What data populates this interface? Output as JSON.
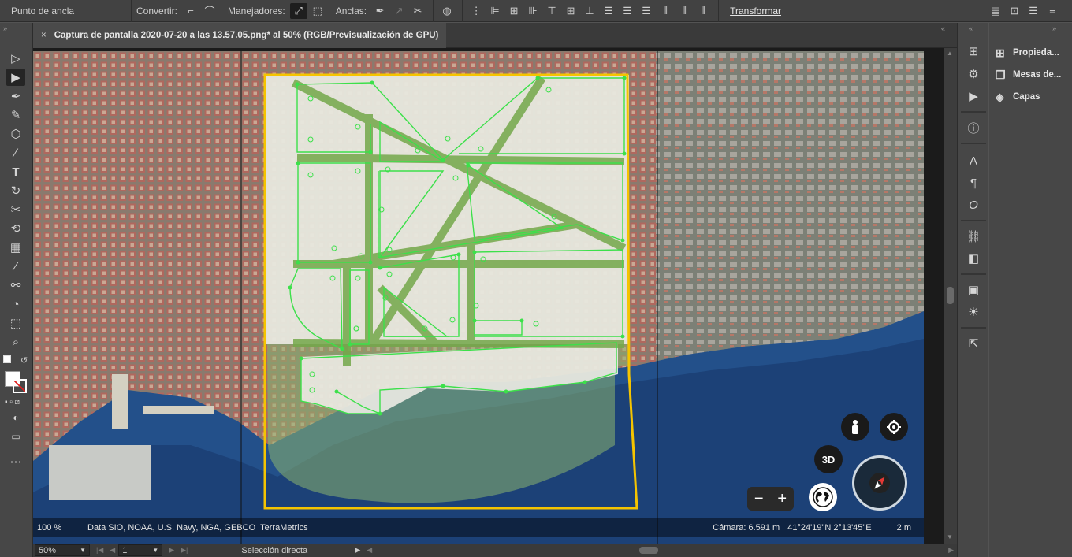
{
  "control_bar": {
    "mode_label": "Punto de ancla",
    "convert_label": "Convertir:",
    "handles_label": "Manejadores:",
    "anchors_label": "Anclas:",
    "transform_label": "Transformar"
  },
  "document": {
    "tab_title": "Captura de pantalla 2020-07-20 a las 13.57.05.png* al 50% (RGB/Previsualización de GPU)",
    "close_glyph": "×"
  },
  "tools": [
    {
      "name": "selection-tool",
      "glyph": "▷"
    },
    {
      "name": "direct-selection-tool",
      "glyph": "▶",
      "active": true
    },
    {
      "name": "pen-tool",
      "glyph": "✒"
    },
    {
      "name": "curvature-tool",
      "glyph": "✎"
    },
    {
      "name": "polygon-tool",
      "glyph": "⬡"
    },
    {
      "name": "paintbrush-tool",
      "glyph": "🖌"
    },
    {
      "name": "type-tool",
      "glyph": "T"
    },
    {
      "name": "rotate-tool",
      "glyph": "↻"
    },
    {
      "name": "scissors-tool",
      "glyph": "✂"
    },
    {
      "name": "lasso-tool",
      "glyph": "⟲"
    },
    {
      "name": "gradient-tool",
      "glyph": "▦"
    },
    {
      "name": "eyedropper-tool",
      "glyph": "💧"
    },
    {
      "name": "blend-tool",
      "glyph": "⚯"
    },
    {
      "name": "shape-builder-tool",
      "glyph": "◔"
    },
    {
      "name": "artboard-tool",
      "glyph": "⬚"
    },
    {
      "name": "zoom-tool",
      "glyph": "🔍"
    }
  ],
  "map": {
    "attribution": "Data SIO, NOAA, U.S. Navy, NGA, GEBCO",
    "provider": "TerraMetrics",
    "zoom_text": "100 %",
    "camera": "Cámara: 6.591 m",
    "coordinates": "41°24'19\"N 2°13'45\"E",
    "scale": "2 m",
    "btn_3d": "3D",
    "minus": "−",
    "plus": "+",
    "colors": {
      "artboard_border": "#f5c400",
      "path_stroke": "#3ce04a",
      "city_overlay": "#ecebe4",
      "sea_overlay": "#8db56f"
    }
  },
  "status": {
    "zoom": "50%",
    "artboard": "1",
    "tool_name": "Selección directa"
  },
  "panels": [
    {
      "label": "Propieda...",
      "icon": "properties-icon"
    },
    {
      "label": "Mesas de...",
      "icon": "artboards-icon"
    },
    {
      "label": "Capas",
      "icon": "layers-icon"
    }
  ]
}
